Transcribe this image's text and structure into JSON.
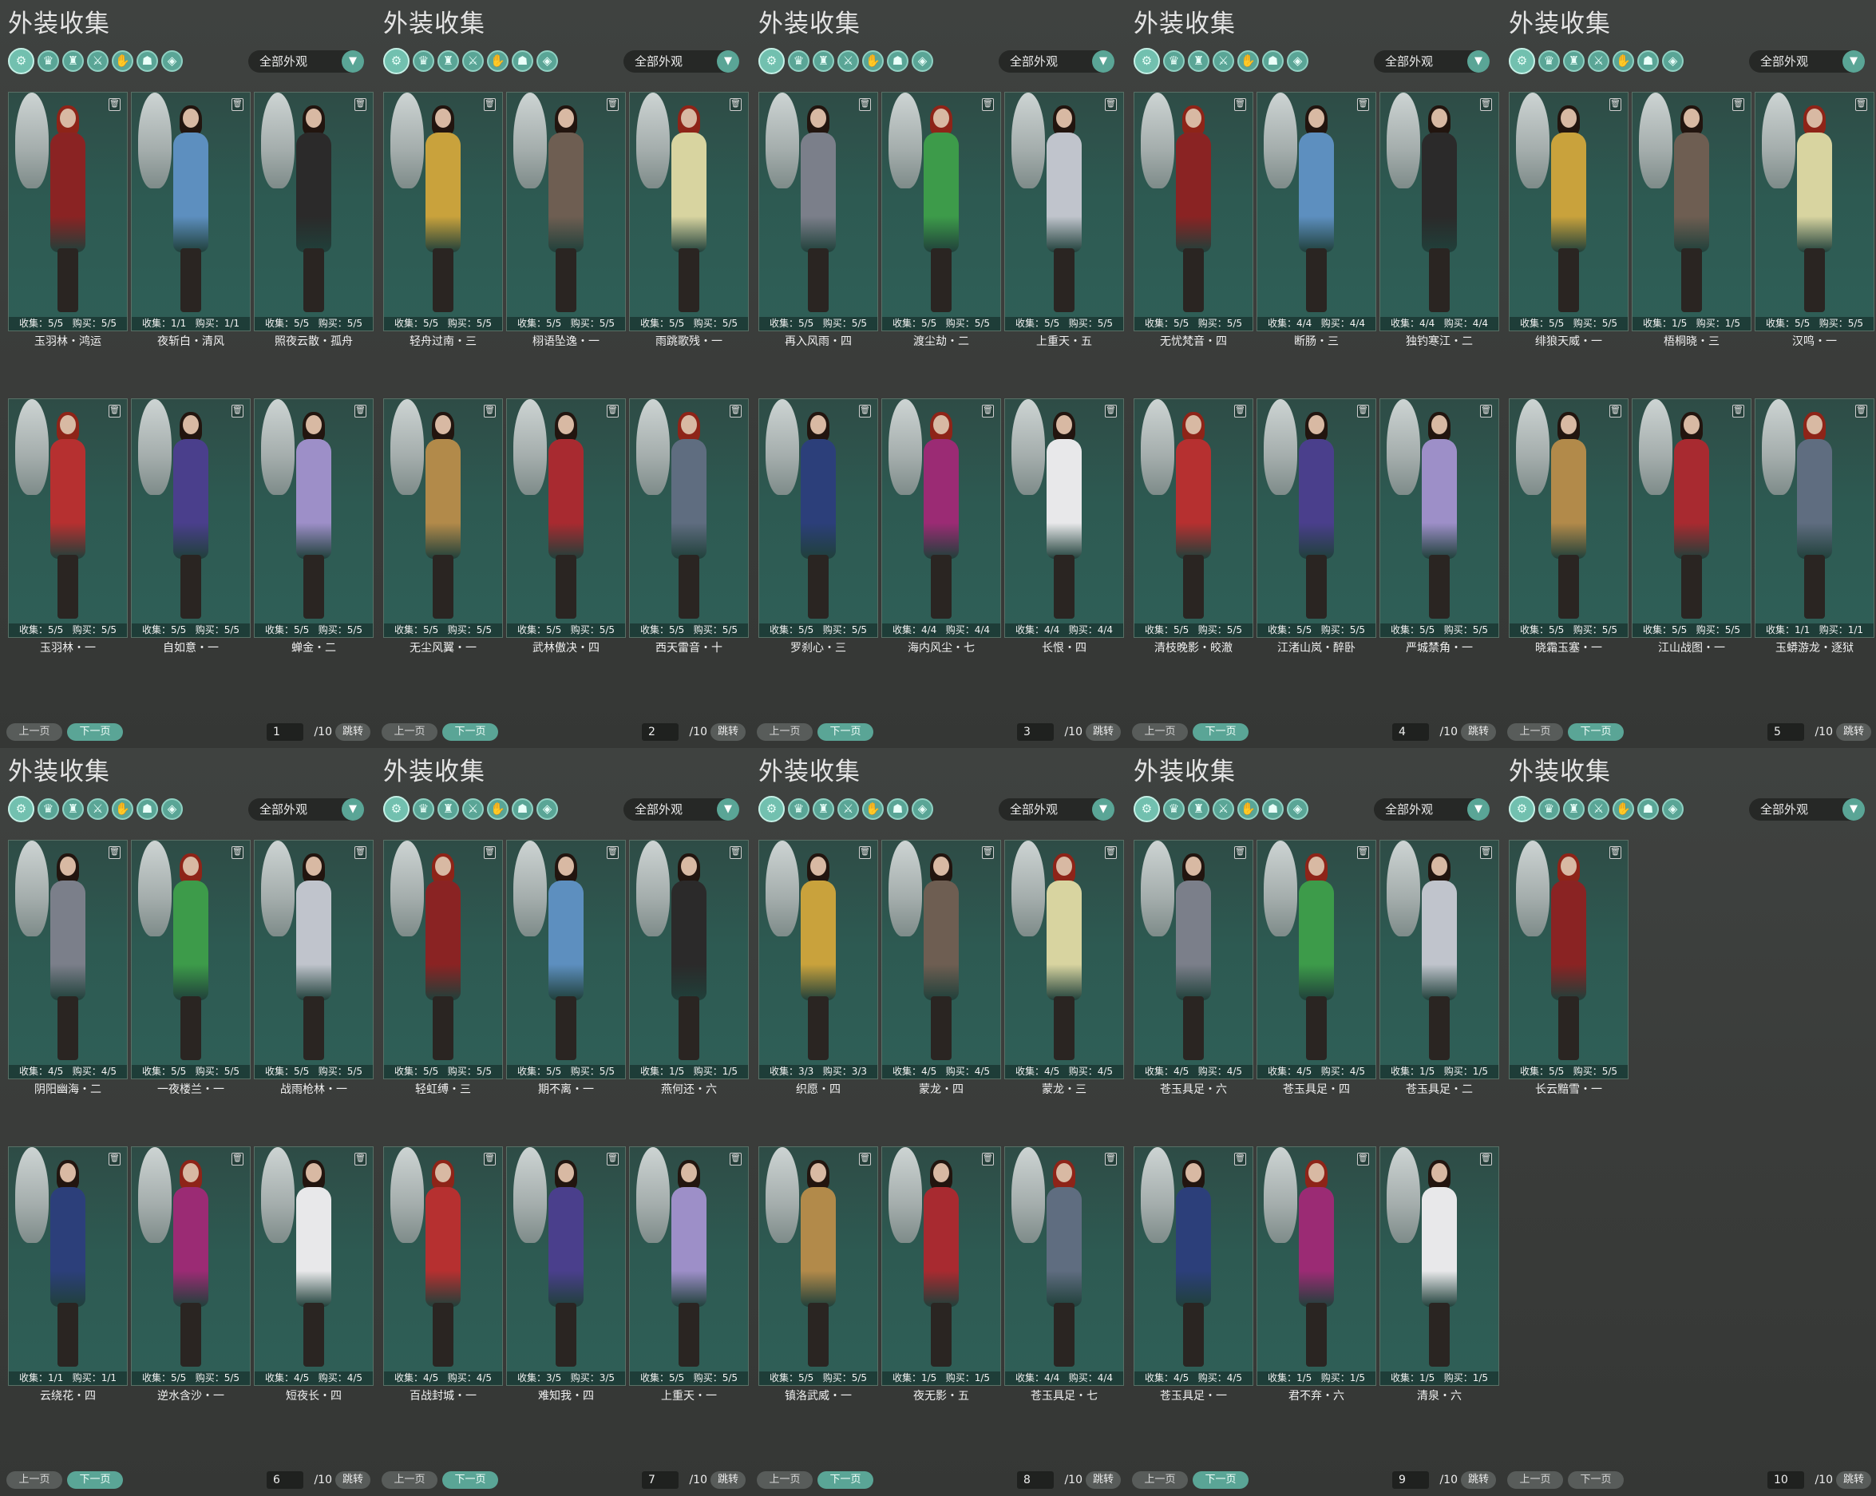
{
  "panel_title": "外装收集",
  "filter_value": "全部外观",
  "prev_label": "上一页",
  "next_label": "下一页",
  "jump_label": "跳转",
  "stat_collect_label": "收集：",
  "stat_buy_label": "购买：",
  "category_tabs": [
    "all-icon",
    "head-icon",
    "top-icon",
    "waist-icon",
    "hand-icon",
    "feet-icon",
    "cloak-icon"
  ],
  "panels": [
    {
      "page": "1",
      "total": "/10",
      "next_enabled": true,
      "items": [
        {
          "name": "玉羽林・鸿运",
          "collect": "5/5",
          "buy": "5/5"
        },
        {
          "name": "夜斩白・清风",
          "collect": "1/1",
          "buy": "1/1"
        },
        {
          "name": "照夜云散・孤舟",
          "collect": "5/5",
          "buy": "5/5"
        },
        {
          "name": "玉羽林・一",
          "collect": "5/5",
          "buy": "5/5"
        },
        {
          "name": "自如意・一",
          "collect": "5/5",
          "buy": "5/5"
        },
        {
          "name": "蝉金・二",
          "collect": "5/5",
          "buy": "5/5"
        }
      ]
    },
    {
      "page": "2",
      "total": "/10",
      "next_enabled": true,
      "items": [
        {
          "name": "轻舟过南・三",
          "collect": "5/5",
          "buy": "5/5"
        },
        {
          "name": "栩语坠逸・一",
          "collect": "5/5",
          "buy": "5/5"
        },
        {
          "name": "雨跳歌残・一",
          "collect": "5/5",
          "buy": "5/5"
        },
        {
          "name": "无尘风翼・一",
          "collect": "5/5",
          "buy": "5/5"
        },
        {
          "name": "武林傲决・四",
          "collect": "5/5",
          "buy": "5/5"
        },
        {
          "name": "西天雷音・十",
          "collect": "5/5",
          "buy": "5/5"
        }
      ]
    },
    {
      "page": "3",
      "total": "/10",
      "next_enabled": true,
      "items": [
        {
          "name": "再入风雨・四",
          "collect": "5/5",
          "buy": "5/5"
        },
        {
          "name": "渡尘劫・二",
          "collect": "5/5",
          "buy": "5/5"
        },
        {
          "name": "上重天・五",
          "collect": "5/5",
          "buy": "5/5"
        },
        {
          "name": "罗刹心・三",
          "collect": "5/5",
          "buy": "5/5"
        },
        {
          "name": "海内风尘・七",
          "collect": "4/4",
          "buy": "4/4"
        },
        {
          "name": "长恨・四",
          "collect": "4/4",
          "buy": "4/4"
        }
      ]
    },
    {
      "page": "4",
      "total": "/10",
      "next_enabled": true,
      "items": [
        {
          "name": "无忧梵音・四",
          "collect": "5/5",
          "buy": "5/5"
        },
        {
          "name": "断肠・三",
          "collect": "4/4",
          "buy": "4/4"
        },
        {
          "name": "独钓寒江・二",
          "collect": "4/4",
          "buy": "4/4"
        },
        {
          "name": "清枝晚影・皎澈",
          "collect": "5/5",
          "buy": "5/5"
        },
        {
          "name": "江渚山岚・醉卧",
          "collect": "5/5",
          "buy": "5/5"
        },
        {
          "name": "严城禁角・一",
          "collect": "5/5",
          "buy": "5/5"
        }
      ]
    },
    {
      "page": "5",
      "total": "/10",
      "next_enabled": true,
      "items": [
        {
          "name": "绯狼天威・一",
          "collect": "5/5",
          "buy": "5/5"
        },
        {
          "name": "梧桐晓・三",
          "collect": "1/5",
          "buy": "1/5"
        },
        {
          "name": "汉鸣・一",
          "collect": "5/5",
          "buy": "5/5"
        },
        {
          "name": "晓霜玉塞・一",
          "collect": "5/5",
          "buy": "5/5"
        },
        {
          "name": "江山战图・一",
          "collect": "5/5",
          "buy": "5/5"
        },
        {
          "name": "玉蟒游龙・逐狱",
          "collect": "1/1",
          "buy": "1/1"
        }
      ]
    },
    {
      "page": "6",
      "total": "/10",
      "next_enabled": true,
      "items": [
        {
          "name": "阴阳幽海・二",
          "collect": "4/5",
          "buy": "4/5"
        },
        {
          "name": "一夜楼兰・一",
          "collect": "5/5",
          "buy": "5/5"
        },
        {
          "name": "战雨枪林・一",
          "collect": "5/5",
          "buy": "5/5"
        },
        {
          "name": "云绕花・四",
          "collect": "1/1",
          "buy": "1/1"
        },
        {
          "name": "逆水含沙・一",
          "collect": "5/5",
          "buy": "5/5"
        },
        {
          "name": "短夜长・四",
          "collect": "4/5",
          "buy": "4/5"
        }
      ]
    },
    {
      "page": "7",
      "total": "/10",
      "next_enabled": true,
      "items": [
        {
          "name": "轻虹缚・三",
          "collect": "5/5",
          "buy": "5/5"
        },
        {
          "name": "期不离・一",
          "collect": "5/5",
          "buy": "5/5"
        },
        {
          "name": "燕何还・六",
          "collect": "1/5",
          "buy": "1/5"
        },
        {
          "name": "百战封城・一",
          "collect": "4/5",
          "buy": "4/5"
        },
        {
          "name": "难知我・四",
          "collect": "3/5",
          "buy": "3/5"
        },
        {
          "name": "上重天・一",
          "collect": "5/5",
          "buy": "5/5"
        }
      ]
    },
    {
      "page": "8",
      "total": "/10",
      "next_enabled": true,
      "items": [
        {
          "name": "织愿・四",
          "collect": "3/3",
          "buy": "3/3"
        },
        {
          "name": "蒙龙・四",
          "collect": "4/5",
          "buy": "4/5"
        },
        {
          "name": "蒙龙・三",
          "collect": "4/5",
          "buy": "4/5"
        },
        {
          "name": "镇洛武威・一",
          "collect": "5/5",
          "buy": "5/5"
        },
        {
          "name": "夜无影・五",
          "collect": "1/5",
          "buy": "1/5"
        },
        {
          "name": "苍玉具足・七",
          "collect": "4/4",
          "buy": "4/4"
        }
      ]
    },
    {
      "page": "9",
      "total": "/10",
      "next_enabled": true,
      "items": [
        {
          "name": "苍玉具足・六",
          "collect": "4/5",
          "buy": "4/5"
        },
        {
          "name": "苍玉具足・四",
          "collect": "4/5",
          "buy": "4/5"
        },
        {
          "name": "苍玉具足・二",
          "collect": "1/5",
          "buy": "1/5"
        },
        {
          "name": "苍玉具足・一",
          "collect": "4/5",
          "buy": "4/5"
        },
        {
          "name": "君不弃・六",
          "collect": "1/5",
          "buy": "1/5"
        },
        {
          "name": "清泉・六",
          "collect": "1/5",
          "buy": "1/5"
        }
      ]
    },
    {
      "page": "10",
      "total": "/10",
      "next_enabled": false,
      "items": [
        {
          "name": "长云黯雪・一",
          "collect": "5/5",
          "buy": "5/5"
        }
      ]
    }
  ],
  "colors": {
    "accent": "#5aa596",
    "card_bg": "#2d5a52",
    "panel_bg": "#3b3d3b"
  }
}
